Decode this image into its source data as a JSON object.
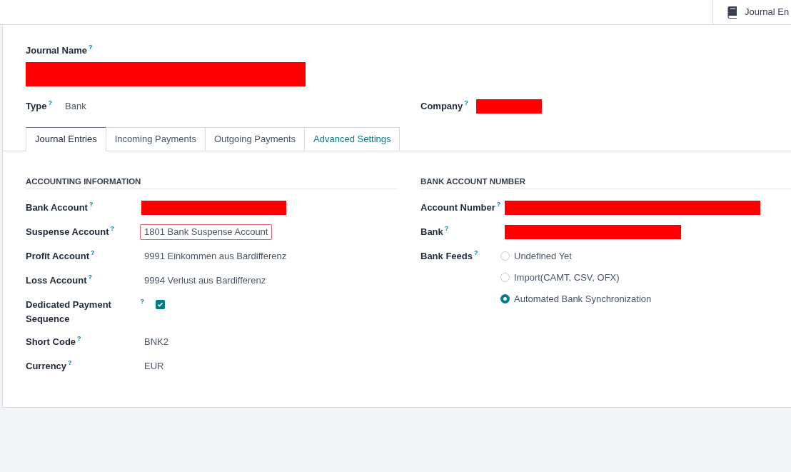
{
  "smart_button": {
    "label": "Journal En"
  },
  "journal_name": {
    "label": "Journal Name",
    "help": "?",
    "redacted": true
  },
  "header_fields": [
    {
      "kind": "text",
      "label": "Type",
      "help": "?",
      "value": "Bank"
    },
    {
      "kind": "redacted",
      "label": "Company",
      "help": "?"
    }
  ],
  "tabs": [
    {
      "label": "Journal Entries",
      "selected": true,
      "debug": false
    },
    {
      "label": "Incoming Payments",
      "selected": false,
      "debug": false
    },
    {
      "label": "Outgoing Payments",
      "selected": false,
      "debug": false
    },
    {
      "label": "Advanced Settings",
      "selected": false,
      "debug": true
    }
  ],
  "sections": [
    {
      "title": "ACCOUNTING INFORMATION",
      "fields": [
        {
          "kind": "redacted",
          "label": "Bank Account",
          "help": "?"
        },
        {
          "kind": "text",
          "label": "Suspense Account",
          "help": "?",
          "value": "1801 Bank Suspense Account",
          "invalid": true
        },
        {
          "kind": "text",
          "label": "Profit Account",
          "help": "?",
          "value": "9991 Einkommen aus Bardifferenz",
          "invalid": false
        },
        {
          "kind": "text",
          "label": "Loss Account",
          "help": "?",
          "value": "9994 Verlust aus Bardifferenz",
          "invalid": false
        },
        {
          "kind": "checkbox",
          "label": "Dedicated Payment Sequence",
          "help": "?",
          "checked": true
        },
        {
          "kind": "text",
          "label": "Short Code",
          "help": "?",
          "value": "BNK2",
          "invalid": false
        },
        {
          "kind": "text",
          "label": "Currency",
          "help": "?",
          "value": "EUR",
          "invalid": false
        }
      ]
    },
    {
      "title": "BANK ACCOUNT NUMBER",
      "fields": [
        {
          "kind": "redacted",
          "label": "Account Number",
          "help": "?"
        },
        {
          "kind": "redacted",
          "label": "Bank",
          "help": "?"
        },
        {
          "kind": "radio",
          "label": "Bank Feeds",
          "help": "?",
          "options": [
            {
              "label": "Undefined Yet",
              "selected": false
            },
            {
              "label": "Import(CAMT, CSV, OFX)",
              "selected": false
            },
            {
              "label": "Automated Bank Synchronization",
              "selected": true
            }
          ]
        }
      ]
    }
  ]
}
